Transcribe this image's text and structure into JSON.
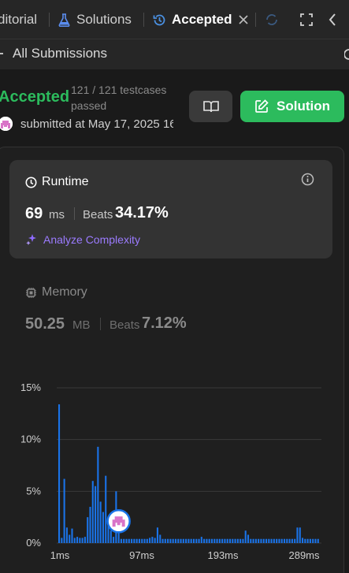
{
  "tabs": {
    "editorial": "ditorial",
    "solutions": "Solutions",
    "accepted": "Accepted"
  },
  "subheader": {
    "back_label": "All Submissions"
  },
  "result": {
    "status": "Accepted",
    "testcases": "121 / 121 testcases passed",
    "submitted": "submitted at May 17, 2025 16"
  },
  "actions": {
    "solution_label": "Solution"
  },
  "runtime": {
    "title": "Runtime",
    "value": "69",
    "unit": "ms",
    "beats_label": "Beats",
    "beats_pct": "34.17%",
    "analyze_label": "Analyze Complexity"
  },
  "memory": {
    "title": "Memory",
    "value": "50.25",
    "unit": "MB",
    "beats_label": "Beats",
    "beats_pct": "7.12%"
  },
  "colors": {
    "accent_green": "#2cbb5d",
    "bar_blue": "#1a73e8",
    "analyze_purple": "#9b7bff"
  },
  "chart_data": {
    "type": "bar",
    "title": "",
    "xlabel": "",
    "ylabel": "",
    "ylim": [
      0,
      15
    ],
    "y_ticks": [
      "15%",
      "10%",
      "5%",
      "0%"
    ],
    "x_ticks": [
      "1ms",
      "97ms",
      "193ms",
      "289ms"
    ],
    "highlight_bar_index": 23,
    "values": [
      13.4,
      0.5,
      6.2,
      1.5,
      0.8,
      1.4,
      0.5,
      0.6,
      0.5,
      0.5,
      0.6,
      2.5,
      3.5,
      6.0,
      5.5,
      9.3,
      4.0,
      3.0,
      6.5,
      2.2,
      1.2,
      0.6,
      5.0,
      1.5,
      0.4,
      0.4,
      0.4,
      0.4,
      0.4,
      0.4,
      0.4,
      0.4,
      0.4,
      0.4,
      0.4,
      0.5,
      0.6,
      0.5,
      1.5,
      0.8,
      0.4,
      0.4,
      0.4,
      0.4,
      0.4,
      0.4,
      0.4,
      0.4,
      0.4,
      0.4,
      0.4,
      0.4,
      0.4,
      0.4,
      0.4,
      0.6,
      0.4,
      0.4,
      0.4,
      0.4,
      0.4,
      0.4,
      0.4,
      0.4,
      0.4,
      0.4,
      0.4,
      0.4,
      0.4,
      0.4,
      0.4,
      0.4,
      1.2,
      0.8,
      0.4,
      0.4,
      0.4,
      0.4,
      0.4,
      0.4,
      0.4,
      0.4,
      0.4,
      0.4,
      0.4,
      0.4,
      0.4,
      0.4,
      0.4,
      0.4,
      0.4,
      0.4,
      1.5,
      1.5,
      0.5,
      0.4,
      0.4,
      0.4,
      0.4,
      0.4,
      0.4
    ]
  }
}
